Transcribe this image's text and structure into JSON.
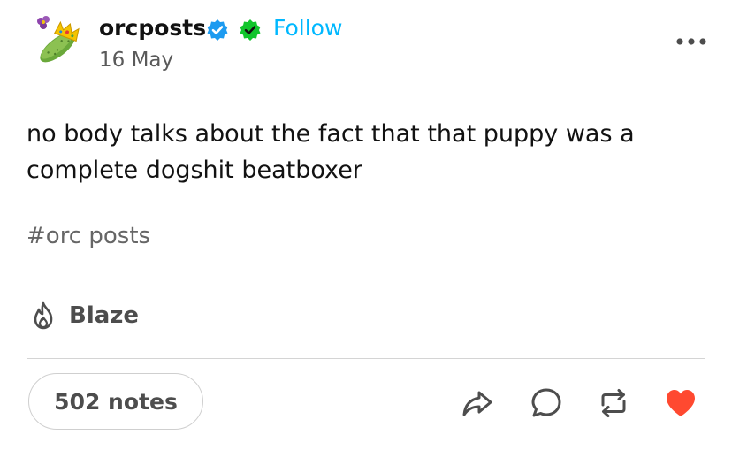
{
  "header": {
    "username": "orcposts",
    "follow_label": "Follow",
    "date": "16 May",
    "avatar_icon": "cucumber-with-crown-icon",
    "badges": [
      "verified-blue-badge-icon",
      "verified-green-badge-icon"
    ],
    "menu_icon": "more-horizontal-icon"
  },
  "post": {
    "text": "no body talks about the fact that that puppy was a complete dogshit beatboxer",
    "tag": "#orc posts"
  },
  "blaze": {
    "label": "Blaze",
    "icon": "flame-icon"
  },
  "footer": {
    "notes_label": "502 notes",
    "actions": [
      "share-icon",
      "reply-icon",
      "reblog-icon",
      "like-icon"
    ]
  },
  "colors": {
    "follow": "#00b8ff",
    "verified_blue": "#1d9bf0",
    "verified_green": "#11c52c",
    "like": "#ff4930",
    "text_primary": "#121212",
    "text_secondary": "#5a5a5a"
  }
}
